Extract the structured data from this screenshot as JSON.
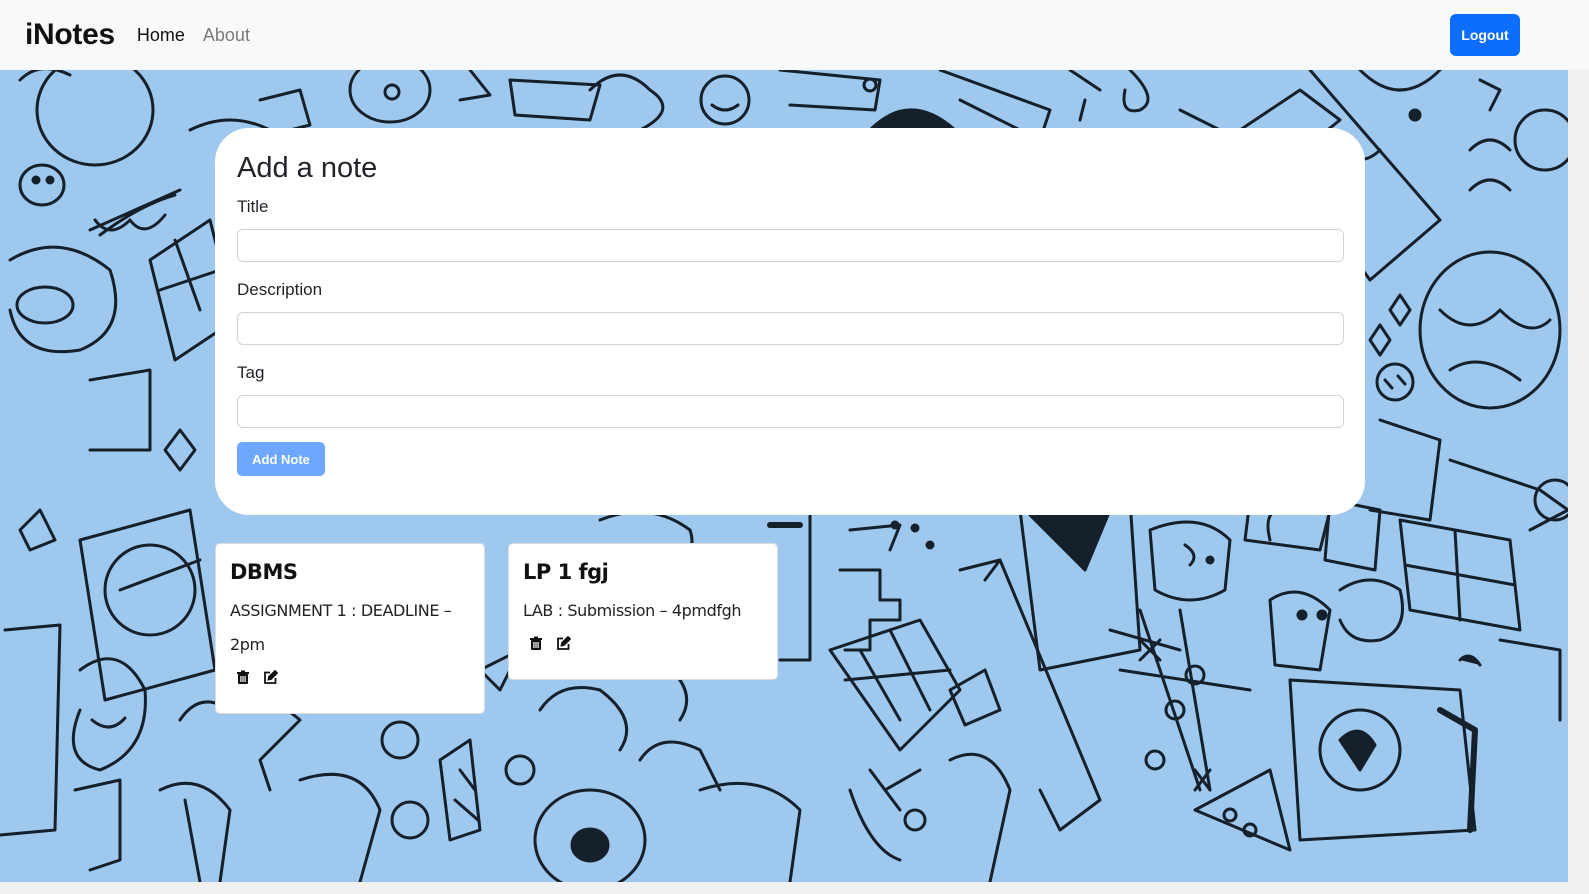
{
  "navbar": {
    "brand": "iNotes",
    "links": [
      {
        "label": "Home"
      },
      {
        "label": "About"
      }
    ],
    "logout_label": "Logout"
  },
  "add_note": {
    "heading": "Add a note",
    "title_label": "Title",
    "title_value": "",
    "description_label": "Description",
    "description_value": "",
    "tag_label": "Tag",
    "tag_value": "",
    "submit_label": "Add Note"
  },
  "notes": [
    {
      "title": "DBMS",
      "description": "ASSIGNMENT 1 : DEADLINE – 2pm",
      "delete_icon": "trash-icon",
      "edit_icon": "edit-icon"
    },
    {
      "title": "LP 1 fgj",
      "description": "LAB : Submission – 4pmdfgh",
      "delete_icon": "trash-icon",
      "edit_icon": "edit-icon"
    }
  ],
  "colors": {
    "primary": "#0d6efd",
    "primary_disabled": "#6ea8fe",
    "background_doodle": "#9ec8ee",
    "navbar": "#f8f9fa"
  }
}
